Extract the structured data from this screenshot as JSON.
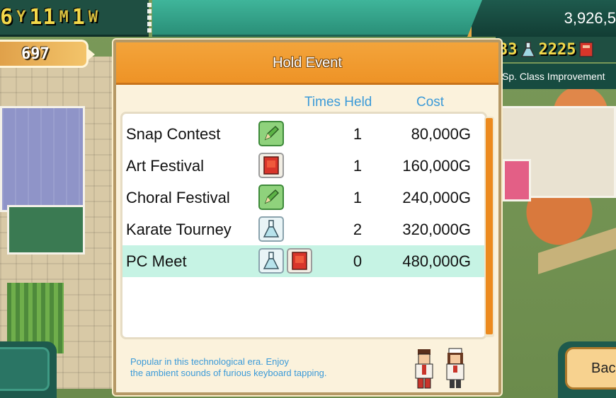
{
  "hud": {
    "date": {
      "year": "6",
      "year_unit": "Y",
      "month": "11",
      "month_unit": "M",
      "week": "1",
      "week_unit": "W"
    },
    "funds": "3,926,5",
    "research_points": "697",
    "resource_left": "33",
    "resource_right": "2225",
    "sp_class_label": "Sp. Class Improvement",
    "back_label": "Back"
  },
  "dialog": {
    "title": "Hold Event",
    "columns": {
      "times_held": "Times Held",
      "cost": "Cost"
    },
    "events": [
      {
        "name": "Snap Contest",
        "icons": [
          "pencil-icon"
        ],
        "times_held": "1",
        "cost": "80,000G",
        "selected": false
      },
      {
        "name": "Art Festival",
        "icons": [
          "book-icon"
        ],
        "times_held": "1",
        "cost": "160,000G",
        "selected": false
      },
      {
        "name": "Choral Festival",
        "icons": [
          "pencil-icon"
        ],
        "times_held": "1",
        "cost": "240,000G",
        "selected": false
      },
      {
        "name": "Karate Tourney",
        "icons": [
          "flask-icon"
        ],
        "times_held": "2",
        "cost": "320,000G",
        "selected": false
      },
      {
        "name": "PC Meet",
        "icons": [
          "flask-icon",
          "book-icon"
        ],
        "times_held": "0",
        "cost": "480,000G",
        "selected": true
      }
    ],
    "description": {
      "line1": "Popular in this technological era. Enjoy",
      "line2": "the ambient sounds of furious keyboard tapping."
    }
  },
  "colors": {
    "header_orange": "#f3a43b",
    "accent_blue": "#3b9ad8",
    "selected_row": "#c6f3e4",
    "scroll_thumb": "#ec8a1e"
  }
}
